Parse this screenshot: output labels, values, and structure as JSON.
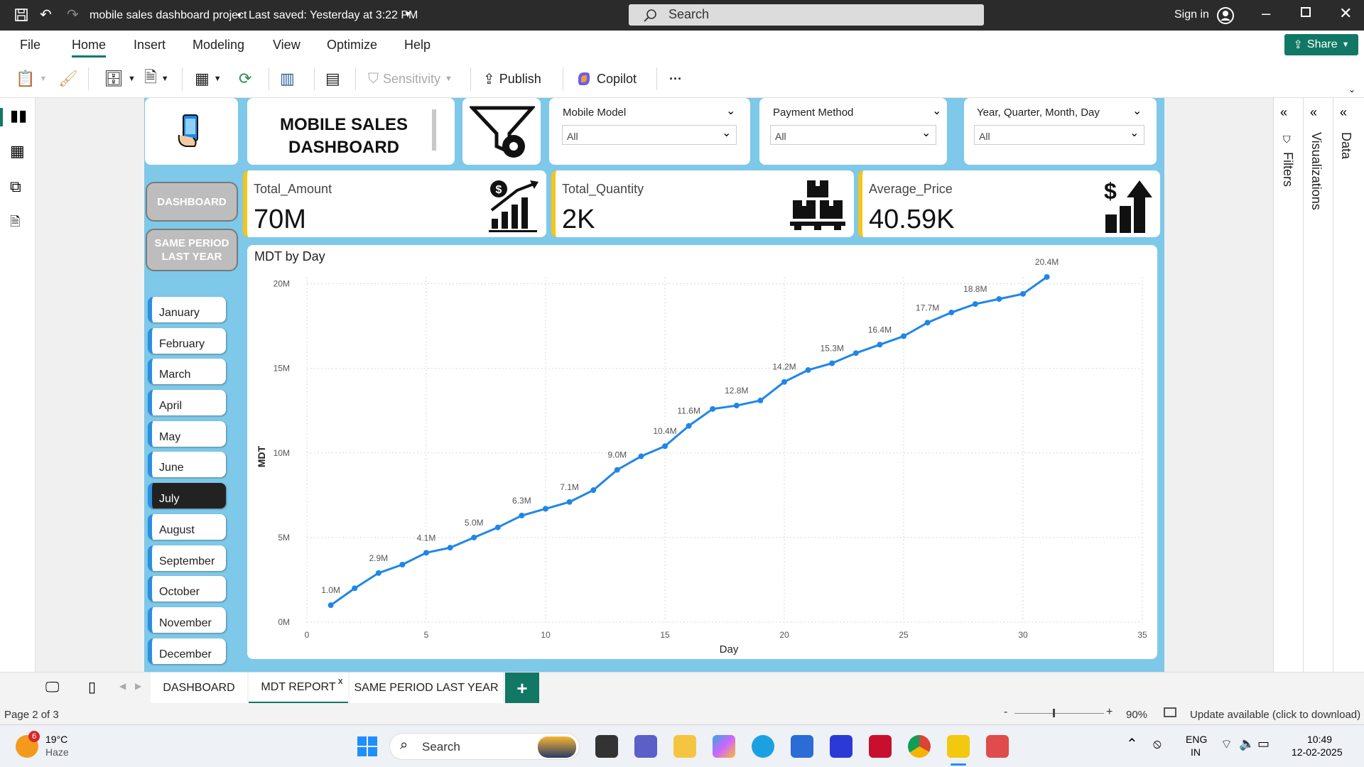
{
  "titlebar": {
    "title": "mobile sales dashboard project",
    "saved": "Last saved: Yesterday at 3:22 PM",
    "search_placeholder": "Search",
    "sign_in": "Sign in"
  },
  "menu": {
    "items": [
      "File",
      "Home",
      "Insert",
      "Modeling",
      "View",
      "Optimize",
      "Help"
    ],
    "active": "Home",
    "share": "Share"
  },
  "toolbar": {
    "sensitivity": "Sensitivity",
    "publish": "Publish",
    "copilot": "Copilot",
    "more": "···"
  },
  "header": {
    "title_line1": "MOBILE SALES",
    "title_line2": "DASHBOARD"
  },
  "slicers": [
    {
      "label": "Mobile Model",
      "value": "All"
    },
    {
      "label": "Payment Method",
      "value": "All"
    },
    {
      "label": "Year, Quarter, Month, Day",
      "value": "All"
    }
  ],
  "kpis": [
    {
      "label": "Total_Amount",
      "value": "70M"
    },
    {
      "label": "Total_Quantity",
      "value": "2K"
    },
    {
      "label": "Average_Price",
      "value": "40.59K"
    }
  ],
  "nav": {
    "dashboard": "DASHBOARD",
    "same_period_1": "SAME PERIOD",
    "same_period_2": "LAST YEAR"
  },
  "months": [
    "January",
    "February",
    "March",
    "April",
    "May",
    "June",
    "July",
    "August",
    "September",
    "October",
    "November",
    "December"
  ],
  "selected_month": "July",
  "chart_data": {
    "type": "line",
    "title": "MDT by Day",
    "xlabel": "Day",
    "ylabel": "MDT",
    "xlim": [
      0,
      35
    ],
    "ylim": [
      0,
      20.4
    ],
    "x_ticks": [
      "0",
      "5",
      "10",
      "15",
      "20",
      "25",
      "30",
      "35"
    ],
    "y_ticks": [
      "0M",
      "5M",
      "10M",
      "15M",
      "20M"
    ],
    "grid": true,
    "color": "#1f86e8",
    "x": [
      1,
      2,
      3,
      4,
      5,
      6,
      7,
      8,
      9,
      10,
      11,
      12,
      13,
      14,
      15,
      16,
      17,
      18,
      19,
      20,
      21,
      22,
      23,
      24,
      25,
      26,
      27,
      28,
      29,
      30,
      31
    ],
    "y": [
      1.0,
      2.0,
      2.9,
      3.4,
      4.1,
      4.4,
      5.0,
      5.6,
      6.3,
      6.7,
      7.1,
      7.8,
      9.0,
      9.8,
      10.4,
      11.6,
      12.6,
      12.8,
      13.1,
      14.2,
      14.9,
      15.3,
      15.9,
      16.4,
      16.9,
      17.7,
      18.3,
      18.8,
      19.1,
      19.4,
      20.4
    ],
    "labels": [
      "1.0M",
      "",
      "2.9M",
      "",
      "4.1M",
      "",
      "5.0M",
      "",
      "6.3M",
      "",
      "7.1M",
      "",
      "9.0M",
      "",
      "10.4M",
      "11.6M",
      "",
      "12.8M",
      "",
      "14.2M",
      "",
      "15.3M",
      "",
      "16.4M",
      "",
      "17.7M",
      "",
      "18.8M",
      "",
      "",
      "20.4M"
    ]
  },
  "right_panes": [
    "Filters",
    "Visualizations",
    "Data"
  ],
  "tabs": [
    "DASHBOARD",
    "MDT REPORT",
    "SAME PERIOD LAST YEAR"
  ],
  "active_tab": "MDT REPORT",
  "tab_close": "x",
  "tab_add": "+",
  "status": {
    "page": "Page 2 of 3",
    "zoom": "90%",
    "update": "Update available (click to download)"
  },
  "taskbar": {
    "weather_temp": "19°C",
    "weather_desc": "Haze",
    "weather_badge": "6",
    "search": "Search",
    "lang1": "ENG",
    "lang2": "IN",
    "time": "10:49",
    "date": "12-02-2025"
  }
}
